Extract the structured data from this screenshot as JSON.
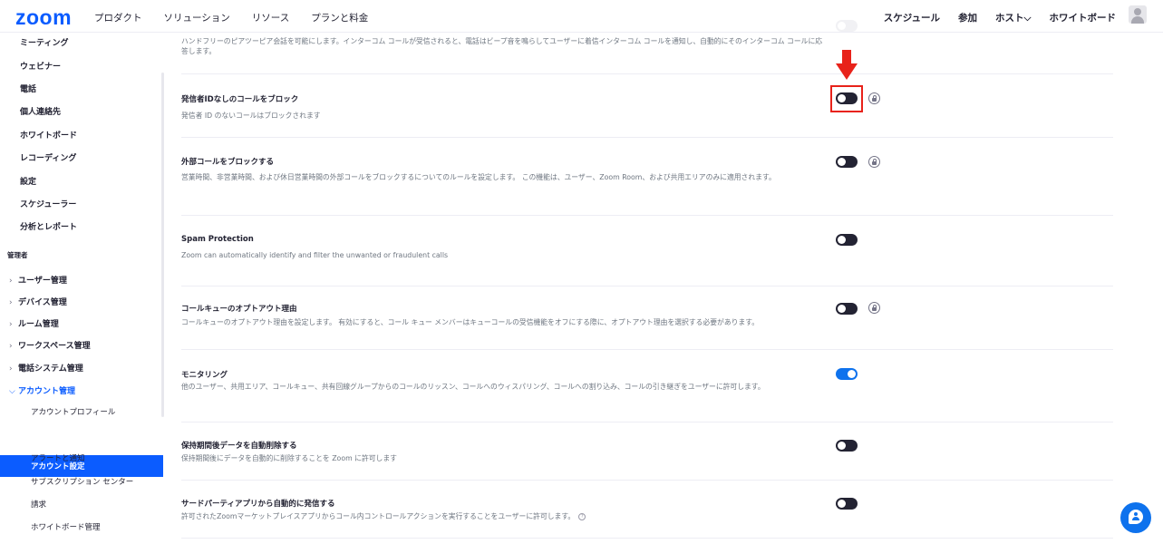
{
  "brand": {
    "logo": "zoom",
    "accent": "#0b5cff",
    "toggle_on": "#0e72ed",
    "highlight": "#e8221a"
  },
  "topnav": {
    "left": [
      "プロダクト",
      "ソリューション",
      "リソース",
      "プランと料金"
    ],
    "right": [
      "スケジュール",
      "参加",
      "ホスト⌵",
      "ホワイトボード"
    ]
  },
  "sidebar": {
    "items": [
      "ミーティング",
      "ウェビナー",
      "電話",
      "個人連絡先",
      "ホワイトボード",
      "レコーディング",
      "設定",
      "スケジューラー",
      "分析とレポート"
    ],
    "section": "管理者",
    "groups": [
      "ユーザー管理",
      "デバイス管理",
      "ルーム管理",
      "ワークスペース管理",
      "電話システム管理",
      "アカウント管理"
    ],
    "chevron_closed": "›",
    "chevron_open": "⌵",
    "sub": [
      "アカウントプロフィール",
      "アカウント設定",
      "アラートと通知",
      "サブスクリプション センター",
      "請求",
      "ホワイトボード管理"
    ],
    "active_index": 1
  },
  "settings": [
    {
      "title": "",
      "desc": "ハンドフリーのピアツーピア会話を可能にします。インターコム コールが受信されると、電話はビープ音を鳴らしてユーザーに着信インターコム コールを通知し、自動的にそのインターコム コールに応答します。",
      "toggle": "off",
      "lock": false
    },
    {
      "title": "発信者IDなしのコールをブロック",
      "desc": "発信者 ID のないコールはブロックされます",
      "toggle": "off",
      "lock": true,
      "highlighted": true
    },
    {
      "title": "外部コールをブロックする",
      "desc": "営業時間、非営業時間、および休日営業時間の外部コールをブロックするについてのルールを設定します。 この機能は、ユーザー、Zoom Room、および共用エリアのみに適用されます。",
      "toggle": "off",
      "lock": true
    },
    {
      "title": "Spam Protection",
      "desc": "Zoom can automatically identify and filter the unwanted or fraudulent calls",
      "toggle": "off",
      "lock": false
    },
    {
      "title": "コールキューのオプトアウト理由",
      "desc": "コールキューのオプトアウト理由を設定します。 有効にすると、コール キュー メンバーはキューコールの受信機能をオフにする際に、オプトアウト理由を選択する必要があります。",
      "toggle": "off",
      "lock": true
    },
    {
      "title": "モニタリング",
      "desc": "他のユーザー、共用エリア、コールキュー、共有回線グループからのコールのリッスン、コールへのウィスパリング、コールへの割り込み、コールの引き継ぎをユーザーに許可します。",
      "toggle": "on",
      "lock": false
    },
    {
      "title": "保持期間後データを自動削除する",
      "desc": "保持期間後にデータを自動的に削除することを Zoom に許可します",
      "toggle": "off",
      "lock": false
    },
    {
      "title": "サードパーティアプリから自動的に発信する",
      "desc": "許可されたZoomマーケットプレイスアプリからコール内コントロールアクションを実行することをユーザーに許可します。",
      "help_icon": "?",
      "toggle": "off",
      "lock": false
    }
  ],
  "icons": {
    "arrow": "down-arrow-icon",
    "lock": "lock-icon",
    "chat": "chat-support-icon",
    "avatar": "user-avatar-icon"
  }
}
